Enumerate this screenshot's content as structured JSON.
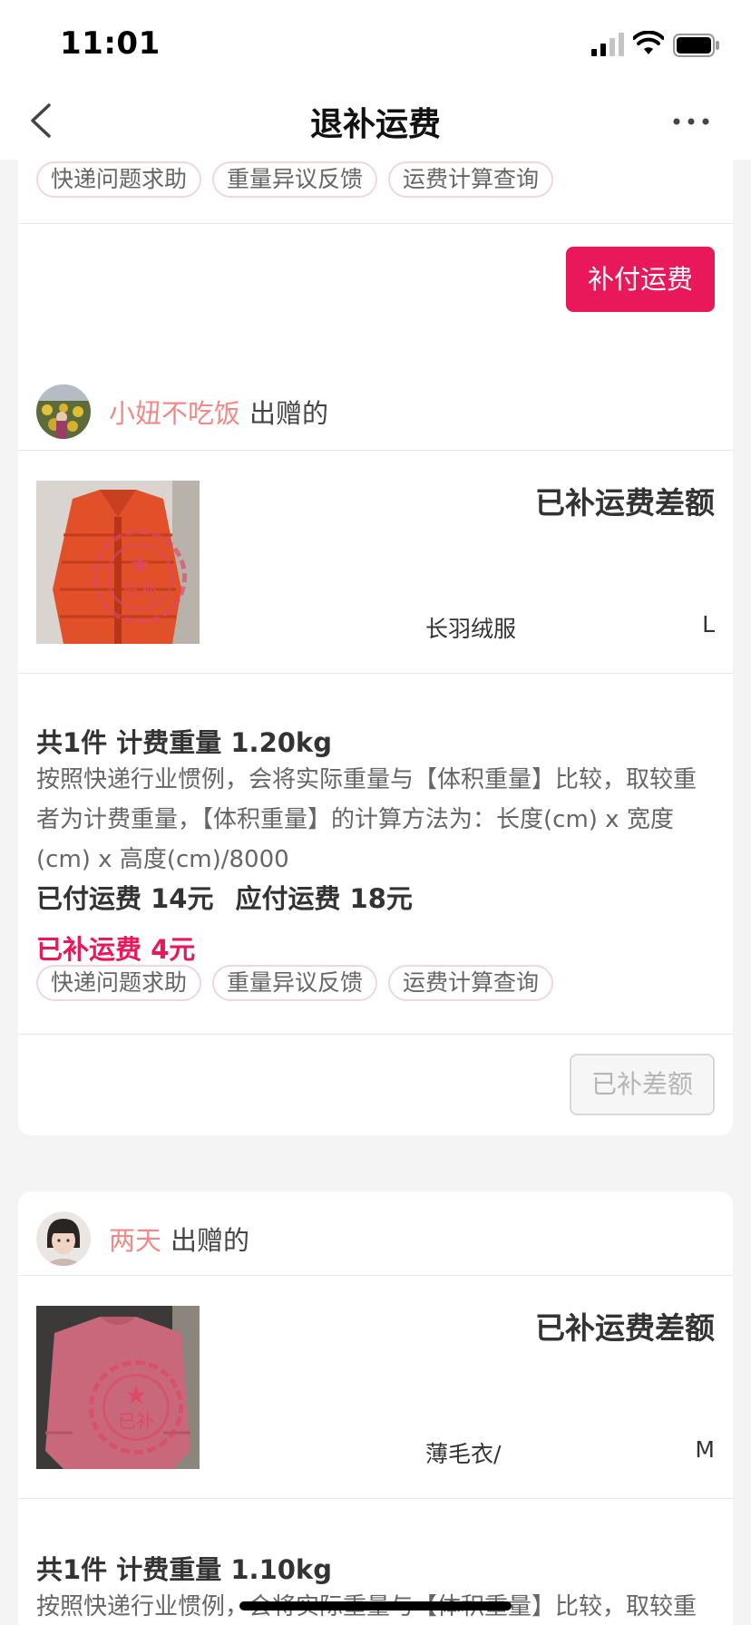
{
  "status_bar": {
    "time": "11:01"
  },
  "nav": {
    "title": "退补运费"
  },
  "common": {
    "chips": [
      "快递问题求助",
      "重量异议反馈",
      "运费计算查询"
    ],
    "gifted_suffix": "出赠的",
    "description": "按照快递行业惯例，会将实际重量与【体积重量】比较，取较重者为计费重量，【体积重量】的计算方法为：长度(cm) x 宽度(cm) x 高度(cm)/8000",
    "stamp_text": "已补"
  },
  "cards": [
    {
      "action_button": "补付运费"
    },
    {
      "username": "小妞不吃饭",
      "status": "已补运费差额",
      "item_name": "长羽绒服",
      "size": "L",
      "summary": "共1件 计费重量 1.20kg",
      "paid_fee": "已付运费 14元",
      "due_fee": "应付运费 18元",
      "extra_paid": "已补运费 4元",
      "action_button": "已补差额"
    },
    {
      "username": "两天",
      "status": "已补运费差额",
      "item_name": "薄毛衣/",
      "size": "M",
      "summary": "共1件 计费重量 1.10kg"
    }
  ],
  "colors": {
    "accent": "#e8185a",
    "username": "#f08a8a"
  }
}
